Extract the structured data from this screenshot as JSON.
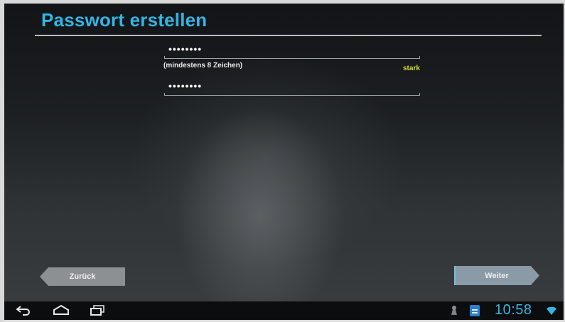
{
  "page": {
    "title": "Passwort erstellen"
  },
  "password_field": {
    "masked_value": "••••••••"
  },
  "confirm_field": {
    "masked_value": "••••••••"
  },
  "hint_text": "(mindestens 8 Zeichen)",
  "strength_label": "stark",
  "buttons": {
    "back_label": "Zurück",
    "next_label": "Weiter"
  },
  "system_bar": {
    "clock": "10:58",
    "icons": [
      "back-icon",
      "home-icon",
      "recent-apps-icon",
      "usb-debug-icon",
      "download-notification-icon",
      "wifi-icon"
    ]
  },
  "colors": {
    "accent": "#33b5e5",
    "strength": "#d6d43a",
    "button": "#8d9092"
  }
}
